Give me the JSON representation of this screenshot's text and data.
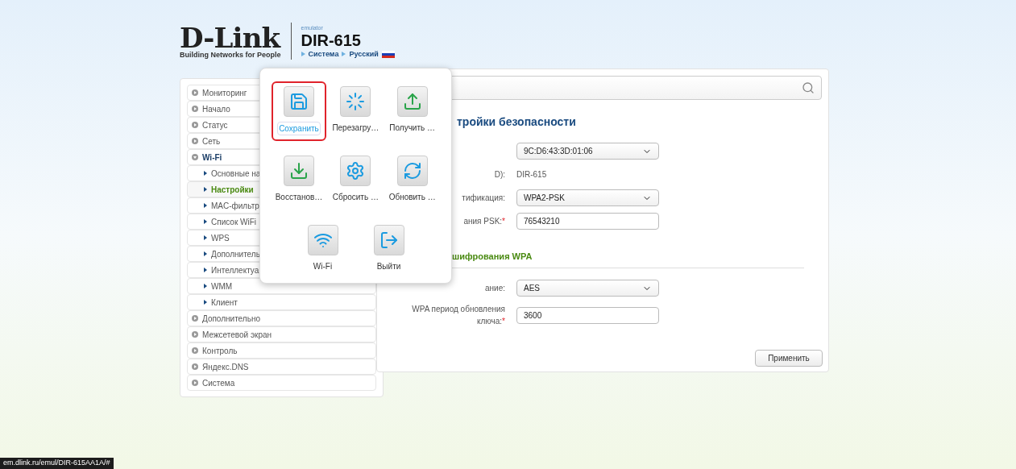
{
  "header": {
    "brand": "D-Link",
    "tagline": "Building Networks for People",
    "emulator": "emulator",
    "model": "DIR-615",
    "breadcrumbs": [
      "Система",
      "Русский"
    ]
  },
  "sidebar": {
    "items": [
      {
        "label": "Мониторинг",
        "kind": "section",
        "selected": false,
        "expanded": false
      },
      {
        "label": "Начало",
        "kind": "section",
        "selected": false,
        "expanded": false
      },
      {
        "label": "Статус",
        "kind": "section",
        "selected": false,
        "expanded": false
      },
      {
        "label": "Сеть",
        "kind": "section",
        "selected": false,
        "expanded": false
      },
      {
        "label": "Wi-Fi",
        "kind": "section",
        "selected": false,
        "expanded": true
      },
      {
        "label": "Основные на",
        "kind": "sub",
        "selected": false
      },
      {
        "label": "Настройки",
        "kind": "sub",
        "selected": true
      },
      {
        "label": "MAC-фильтр",
        "kind": "sub",
        "selected": false
      },
      {
        "label": "Список WiFi",
        "kind": "sub",
        "selected": false
      },
      {
        "label": "WPS",
        "kind": "sub",
        "selected": false
      },
      {
        "label": "Дополнитель",
        "kind": "sub",
        "selected": false
      },
      {
        "label": "Интеллектуа",
        "kind": "sub",
        "selected": false
      },
      {
        "label": "WMM",
        "kind": "sub",
        "selected": false
      },
      {
        "label": "Клиент",
        "kind": "sub",
        "selected": false
      },
      {
        "label": "Дополнительно",
        "kind": "section",
        "selected": false,
        "expanded": false
      },
      {
        "label": "Межсетевой экран",
        "kind": "section",
        "selected": false,
        "expanded": false
      },
      {
        "label": "Контроль",
        "kind": "section",
        "selected": false,
        "expanded": false
      },
      {
        "label": "Яндекс.DNS",
        "kind": "section",
        "selected": false,
        "expanded": false
      },
      {
        "label": "Система",
        "kind": "section",
        "selected": false,
        "expanded": false
      }
    ]
  },
  "popup": {
    "items": [
      {
        "label": "Сохранить",
        "selected": true
      },
      {
        "label": "Перезагру…",
        "selected": false
      },
      {
        "label": "Получить …",
        "selected": false
      },
      {
        "label": "Восстанов…",
        "selected": false
      },
      {
        "label": "Сбросить …",
        "selected": false
      },
      {
        "label": "Обновить …",
        "selected": false
      },
      {
        "label": "Wi-Fi",
        "selected": false
      },
      {
        "label": "Выйти",
        "selected": false
      }
    ]
  },
  "content": {
    "title": "тройки безопасности",
    "rows": [
      {
        "kind": "select",
        "value": "9C:D6:43:3D:01:06"
      },
      {
        "label": "D):",
        "kind": "text",
        "value": "DIR-615"
      },
      {
        "label": "тификация:",
        "kind": "select",
        "value": "WPA2-PSK"
      },
      {
        "label": "ания PSK:",
        "mark": "*",
        "kind": "input",
        "value": "76543210"
      }
    ],
    "section": "шифрования WPA",
    "rows2": [
      {
        "label": "ание:",
        "kind": "select",
        "value": "AES"
      },
      {
        "label": "WPA период обновления ключа:",
        "mark": "*",
        "kind": "input",
        "value": "3600"
      }
    ],
    "apply": "Применить"
  },
  "status_bar": "em.dlink.ru/emul/DIR-615AA1A/#"
}
